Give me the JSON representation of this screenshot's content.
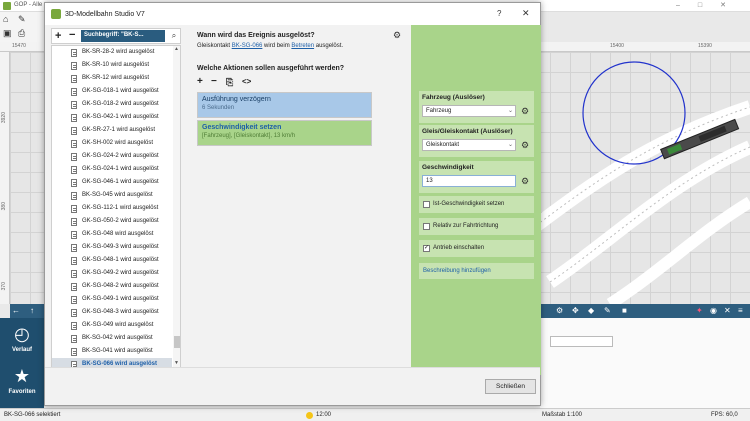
{
  "app": {
    "title": "GOP - Alle",
    "statusbar": {
      "left": "BK-SG-066 selektiert",
      "time": "12:00",
      "scale": "Maßstab 1:100",
      "fps": "FPS: 60,0"
    },
    "ruler_top": [
      "15470",
      "15400",
      "15390"
    ],
    "ruler_left": [
      "3920",
      "380",
      "370"
    ],
    "left_panel": [
      {
        "label": "Verlauf",
        "icon": "clock-icon"
      },
      {
        "label": "Favoriten",
        "icon": "star-icon"
      }
    ]
  },
  "dialog": {
    "title": "3D-Modellbahn Studio V7",
    "help_glyph": "?",
    "close_glyph": "✕",
    "search": {
      "value": "Suchbegriff: \"BK-S..."
    },
    "list": [
      "BK-SR-28-2 wird ausgelöst",
      "BK-SR-10 wird ausgelöst",
      "BK-SR-12 wird ausgelöst",
      "GK-SG-018-1 wird ausgelöst",
      "GK-SG-018-2 wird ausgelöst",
      "GK-SG-042-1 wird ausgelöst",
      "GK-SR-27-1 wird ausgelöst",
      "GK-SH-002 wird ausgelöst",
      "GK-SG-024-2 wird ausgelöst",
      "GK-SG-024-1 wird ausgelöst",
      "GK-SG-046-1 wird ausgelöst",
      "BK-SG-045 wird ausgelöst",
      "GK-SG-112-1 wird ausgelöst",
      "GK-SG-050-2 wird ausgelöst",
      "GK-SG-048 wird ausgelöst",
      "GK-SG-049-3 wird ausgelöst",
      "GK-SG-048-1 wird ausgelöst",
      "GK-SG-049-2 wird ausgelöst",
      "GK-SG-048-2 wird ausgelöst",
      "GK-SG-049-1 wird ausgelöst",
      "GK-SG-048-3 wird ausgelöst",
      "GK-SG-049 wird ausgelöst",
      "BK-SG-042 wird ausgelöst",
      "BK-SG-041 wird ausgelöst",
      "BK-SG-066 wird ausgelöst"
    ],
    "selected_index": 24,
    "event": {
      "question1": "Wann wird das Ereignis ausgelöst?",
      "desc_prefix": "Gleiskontakt ",
      "desc_link1": "BK-SG-066",
      "desc_mid": " wird beim ",
      "desc_link2": "Betreten",
      "desc_suffix": " ausgelöst.",
      "question2": "Welche Aktionen sollen ausgeführt werden?",
      "actions": [
        {
          "title": "Ausführung verzögern",
          "sub": "6 Sekunden"
        },
        {
          "title": "Geschwindigkeit setzen",
          "sub": "[Fahrzeug], [Gleiskontakt], 13 km/h"
        }
      ]
    },
    "props": {
      "vehicle": {
        "label": "Fahrzeug (Auslöser)",
        "value": "Fahrzeug"
      },
      "contact": {
        "label": "Gleis/Gleiskontakt (Auslöser)",
        "value": "Gleiskontakt"
      },
      "speed": {
        "label": "Geschwindigkeit",
        "value": "13"
      },
      "checks": [
        {
          "label": "Ist-Geschwindigkeit setzen",
          "checked": false
        },
        {
          "label": "Relativ zur Fahrtrichtung",
          "checked": false
        },
        {
          "label": "Antrieb einschalten",
          "checked": true
        }
      ],
      "add_description": "Beschreibung hinzufügen"
    },
    "close_button": "Schließen"
  },
  "colors": {
    "accent_blue": "#2a5c7f",
    "action_blue": "#a8c8e8",
    "action_green": "#a9d48a",
    "link": "#1d5fa8"
  }
}
